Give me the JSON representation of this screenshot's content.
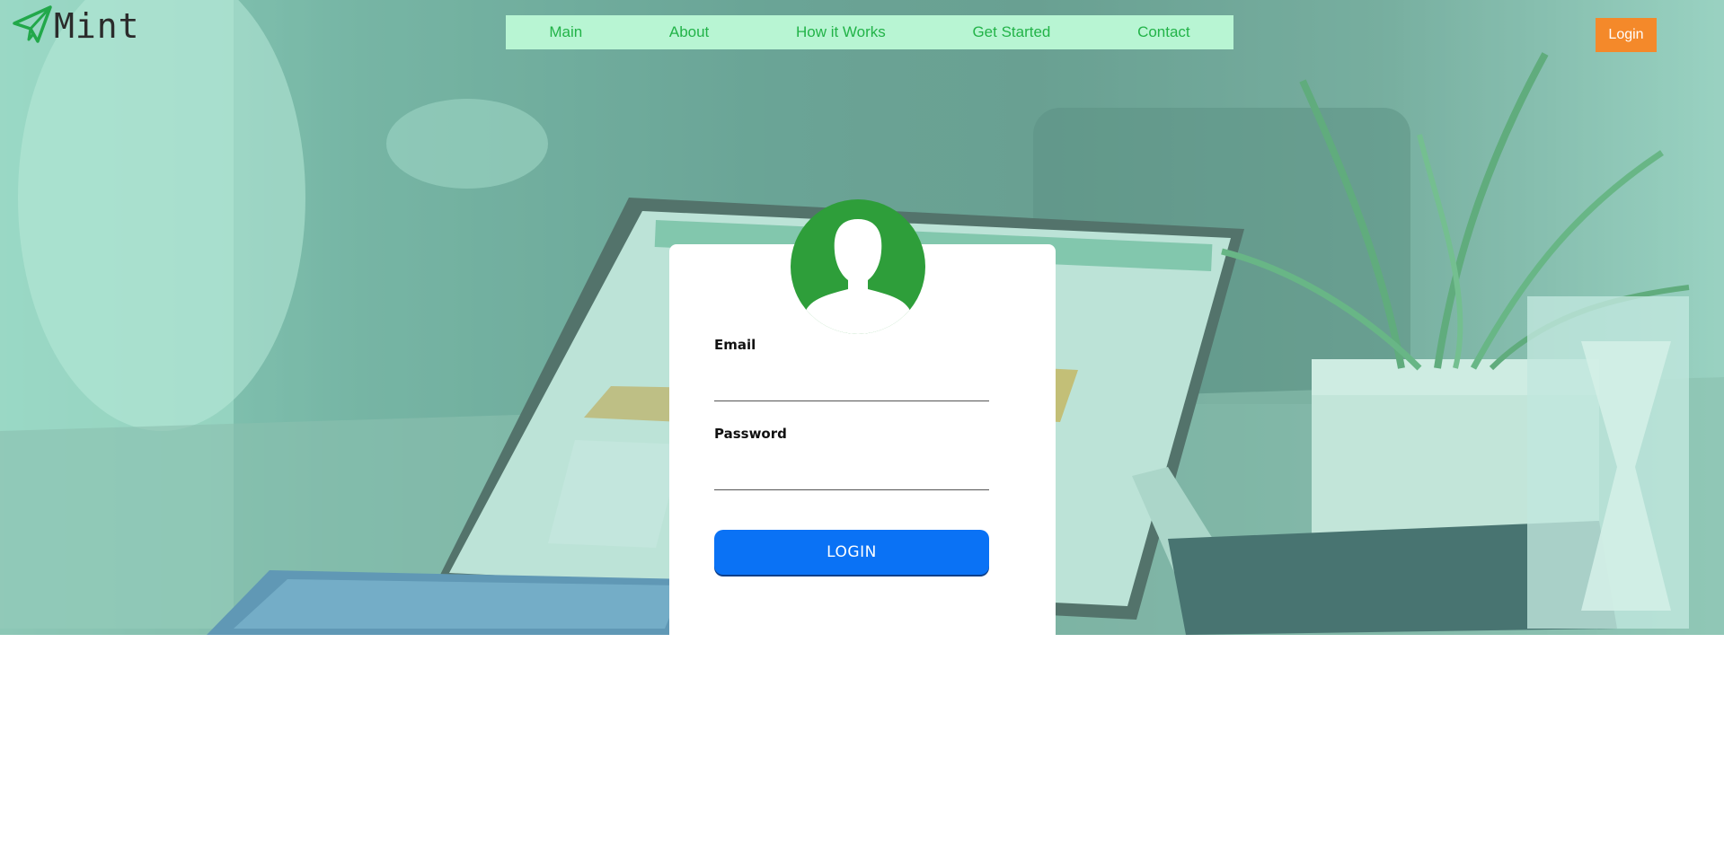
{
  "brand": {
    "name": "Mint",
    "logo_icon": "paper-plane-icon",
    "accent": "#22b348"
  },
  "nav": {
    "items": [
      {
        "label": "Main"
      },
      {
        "label": "About"
      },
      {
        "label": "How it Works"
      },
      {
        "label": "Get Started"
      },
      {
        "label": "Contact"
      }
    ],
    "background": "#b8f5d3"
  },
  "header": {
    "login_label": "Login",
    "login_color": "#f4892a"
  },
  "login_form": {
    "avatar_icon": "user-avatar-icon",
    "email_label": "Email",
    "email_value": "",
    "password_label": "Password",
    "password_value": "",
    "submit_label": "LOGIN",
    "submit_color": "#0a72f5"
  }
}
